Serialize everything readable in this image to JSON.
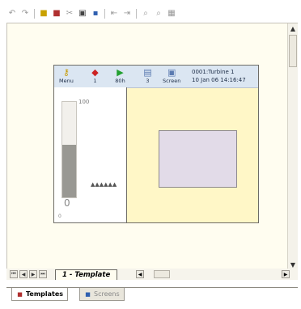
{
  "toolbar": {
    "icons": [
      "undo-icon",
      "redo-icon",
      "copy-icon",
      "paste-icon",
      "cut-icon",
      "insert-icon",
      "delete-icon",
      "align-left-icon",
      "align-right-icon",
      "find-icon",
      "find-next-icon",
      "grid-icon"
    ]
  },
  "screen_header": {
    "items": [
      {
        "name": "menu",
        "label": "Menu",
        "icon": "key-icon"
      },
      {
        "name": "alarm",
        "label": "1",
        "icon": "bell-icon"
      },
      {
        "name": "play",
        "label": "80h",
        "icon": "play-icon"
      },
      {
        "name": "doc",
        "label": "3",
        "icon": "document-icon"
      },
      {
        "name": "screen",
        "label": "Screen",
        "icon": "screen-icon"
      }
    ],
    "info_line1": "0001:Turbine 1",
    "info_line2": "10 Jan 06  14:16:47"
  },
  "gauge": {
    "max_label": "100",
    "zero_label": "0",
    "small_zero_label": "0",
    "fill_fraction": 0.55,
    "peaks": "▲▲▲▲▲▲"
  },
  "bottom_strip": {
    "page_tab": "1 - Template"
  },
  "tabs": [
    {
      "label": "Templates",
      "active": true,
      "icon": "templates-icon"
    },
    {
      "label": "Screens",
      "active": false,
      "icon": "screens-icon"
    }
  ],
  "colors": {
    "page_bg": "#fff7c7",
    "header_bg": "#dbe6f2",
    "rect": "#e2dbe8",
    "gauge_fill": "#999893"
  }
}
